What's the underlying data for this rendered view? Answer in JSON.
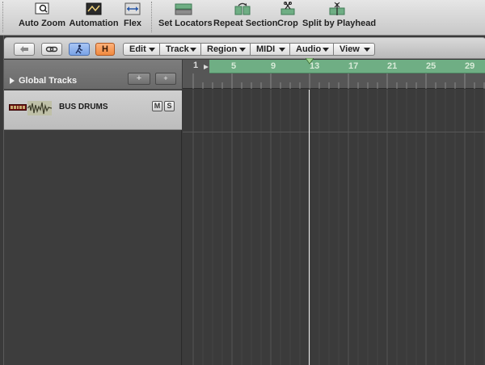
{
  "toolbar": {
    "buttons": [
      {
        "label": "Auto Zoom",
        "icon": "auto-zoom-icon"
      },
      {
        "label": "Automation",
        "icon": "automation-icon"
      },
      {
        "label": "Flex",
        "icon": "flex-icon"
      },
      {
        "label": "Set Locators",
        "icon": "set-locators-icon"
      },
      {
        "label": "Repeat Section",
        "icon": "repeat-section-icon"
      },
      {
        "label": "Crop",
        "icon": "crop-icon"
      },
      {
        "label": "Split by Playhead",
        "icon": "split-by-playhead-icon"
      }
    ]
  },
  "local_bar": {
    "toggles": [
      {
        "icon": "back-arrow-icon"
      },
      {
        "icon": "link-icon"
      },
      {
        "icon": "catch-playhead-icon"
      },
      {
        "label": "H",
        "icon": "hide-icon"
      }
    ],
    "menus": [
      "Edit",
      "Track",
      "Region",
      "MIDI",
      "Audio",
      "View"
    ]
  },
  "global_tracks": {
    "label": "Global Tracks",
    "add_symbol": "+",
    "add_folder_symbol": "+"
  },
  "track": {
    "name": "BUS DRUMS",
    "mute": "M",
    "solo": "S",
    "color": "#6d1010"
  },
  "ruler": {
    "start_bar": "1",
    "bars": [
      "5",
      "9",
      "13",
      "17",
      "21",
      "25",
      "29"
    ],
    "cycle_color": "#6fae84"
  },
  "colors": {
    "accent_blue": "#8eb5f0",
    "accent_orange": "#f0924a",
    "playhead": "#f2f2f2"
  }
}
